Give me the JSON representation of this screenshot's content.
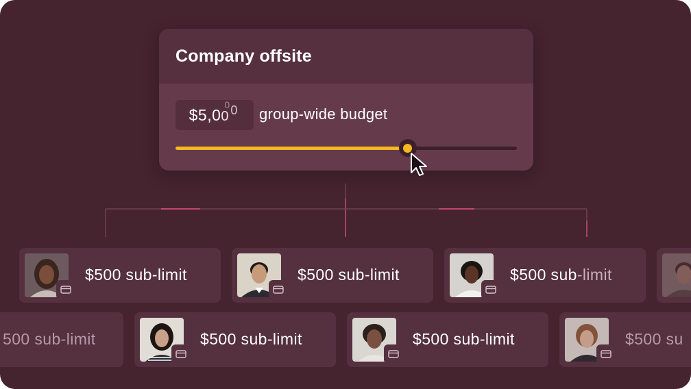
{
  "card": {
    "title": "Company offsite",
    "amount_prefix": "$5,0",
    "amount_rolling": [
      "0",
      "0",
      "0"
    ],
    "budget_label": "group-wide budget",
    "slider_fraction": 0.68
  },
  "colors": {
    "background": "#45232f",
    "card_header": "#56303f",
    "card_body": "#653b4b",
    "accent": "#f5b820",
    "connector_highlight": "#c4476f"
  },
  "sub_limits_row1": [
    {
      "label": "$500 sub-limit",
      "avatar": "person-avatar-1"
    },
    {
      "label": "$500 sub-limit",
      "avatar": "person-avatar-2"
    },
    {
      "label_main": "$500 sub",
      "label_dim": "-limit",
      "avatar": "person-avatar-3"
    },
    {
      "label": "",
      "avatar": "person-avatar-4"
    }
  ],
  "sub_limits_row2": [
    {
      "label": "500 sub-limit"
    },
    {
      "label": "$500 sub-limit",
      "avatar": "person-avatar-5"
    },
    {
      "label": "$500 sub-limit",
      "avatar": "person-avatar-6"
    },
    {
      "label": "$500 su",
      "avatar": "person-avatar-7"
    }
  ]
}
